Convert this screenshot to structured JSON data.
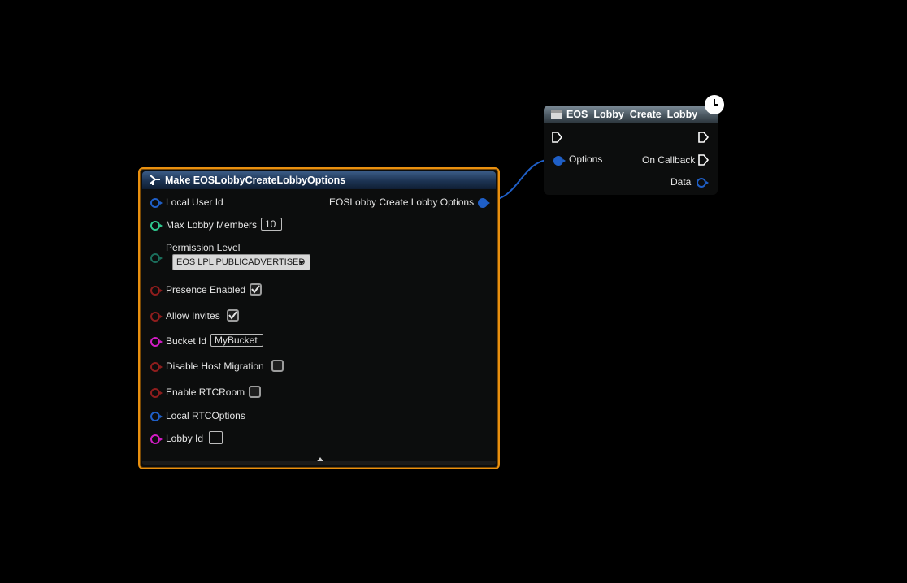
{
  "make_node": {
    "title": "Make EOSLobbyCreateLobbyOptions",
    "output_label": "EOSLobby Create Lobby Options",
    "rows": {
      "local_user_id": "Local User Id",
      "max_lobby_members": "Max Lobby Members",
      "max_lobby_members_value": "10",
      "permission_level": "Permission Level",
      "permission_level_value": "EOS LPL PUBLICADVERTISED",
      "presence_enabled": "Presence Enabled",
      "presence_enabled_checked": true,
      "allow_invites": "Allow Invites",
      "allow_invites_checked": true,
      "bucket_id": "Bucket Id",
      "bucket_id_value": "MyBucket",
      "disable_host_migration": "Disable Host Migration",
      "disable_host_migration_checked": false,
      "enable_rtc_room": "Enable RTCRoom",
      "enable_rtc_room_checked": false,
      "local_rtc_options": "Local RTCOptions",
      "lobby_id": "Lobby Id",
      "lobby_id_value": ""
    }
  },
  "create_node": {
    "title": "EOS_Lobby_Create_Lobby",
    "options_label": "Options",
    "on_callback_label": "On Callback",
    "data_label": "Data"
  },
  "colors": {
    "selection_outline": "#e9900f",
    "struct_pin": "#1f5fc7",
    "int_pin": "#2fc98f",
    "enum_pin": "#1b6e5c",
    "bool_pin": "#8f1d1d",
    "string_pin": "#d21cc4"
  },
  "icons": {
    "make_node_icon": "make-struct-icon",
    "create_node_icon": "function-icon",
    "latent_icon": "clock-icon"
  }
}
